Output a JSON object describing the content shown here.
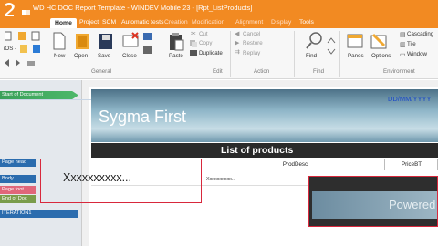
{
  "window": {
    "title": "WD HC DOC Report Template - WINDEV Mobile 23 - [Rpt_ListProducts]"
  },
  "tabs": [
    {
      "label": "Home"
    },
    {
      "label": "Project"
    },
    {
      "label": "SCM"
    },
    {
      "label": "Automatic tests"
    },
    {
      "label": "Creation"
    },
    {
      "label": "Modification"
    },
    {
      "label": "Alignment"
    },
    {
      "label": "Display"
    },
    {
      "label": "Tools"
    }
  ],
  "ribbon": {
    "platform_label": "iOS -",
    "new": "New",
    "open": "Open",
    "save": "Save",
    "close": "Close",
    "paste": "Paste",
    "cut": "Cut",
    "copy": "Copy",
    "duplicate": "Duplicate",
    "cancel": "Cancel",
    "restore": "Restore",
    "replay": "Replay",
    "find": "Find",
    "panes": "Panes",
    "options": "Options",
    "cascading": "Cascading",
    "tile": "Tile",
    "window": "Window",
    "groups": {
      "general": "General",
      "edit": "Edit",
      "action": "Action",
      "find": "Find",
      "environment": "Environment"
    }
  },
  "sections": {
    "start_of_document": "Start of Document",
    "page_header": "Page heac",
    "body": "Body",
    "page_footer": "Page foot",
    "end_of_doc": "End of Doc",
    "iteration": "ITERATION1"
  },
  "report": {
    "company": "Sygma First",
    "date_placeholder": "DD/MM/YYYY",
    "list_title": "List of products",
    "columns": [
      "ProdDesc",
      "PriceBT"
    ],
    "placeholder_big": "Xxxxxxxxxx...",
    "placeholder_small": "Xxxxxxxxxx...",
    "powered": "Powered b"
  },
  "colors": {
    "accent": "#f28a22",
    "selection": "#d8283c",
    "date": "#1947c8"
  }
}
